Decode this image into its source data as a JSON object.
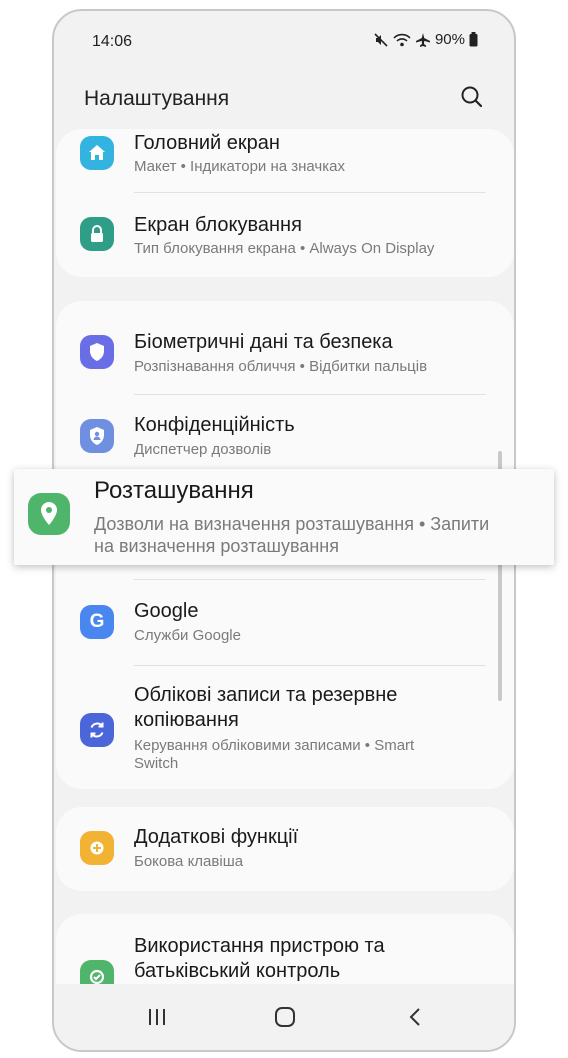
{
  "status": {
    "time": "14:06",
    "battery": "90%"
  },
  "header": {
    "title": "Налаштування"
  },
  "items": {
    "home": {
      "title": "Головний екран",
      "sub": "Макет  •  Індикатори на значках",
      "color": "#33b3e0",
      "icon": "home-icon"
    },
    "lock": {
      "title": "Екран блокування",
      "sub": "Тип блокування екрана  •  Always On Display",
      "color": "#2f9e86",
      "icon": "lock-icon"
    },
    "biometrics": {
      "title": "Біометричні дані та безпека",
      "sub": "Розпізнавання обличчя  •  Відбитки пальців",
      "color": "#6a6ee6",
      "icon": "shield-icon"
    },
    "privacy": {
      "title": "Конфіденційність",
      "sub": "Диспетчер дозволів",
      "color": "#6f8fe0",
      "icon": "privacy-shield-icon"
    },
    "google": {
      "title": "Google",
      "sub": "Служби Google",
      "color": "#4a86f0",
      "icon": "google-icon"
    },
    "accounts": {
      "title": "Облікові записи та резервне копіювання",
      "sub": "Керування обліковими записами  •  Smart Switch",
      "color": "#4a66d8",
      "icon": "sync-icon"
    },
    "advanced": {
      "title": "Додаткові функції",
      "sub": "Бокова клавіша",
      "color": "#f2b233",
      "icon": "gear-plus-icon"
    },
    "wellbeing": {
      "title": "Використання пристрою та батьківський контроль",
      "color": "#4fb56a",
      "icon": "wellbeing-icon"
    }
  },
  "highlight": {
    "title": "Розташування",
    "sub": "Дозволи на визначення розташування  •  Запити на визначення розташування",
    "color": "#4fb56a",
    "icon": "location-pin-icon"
  }
}
